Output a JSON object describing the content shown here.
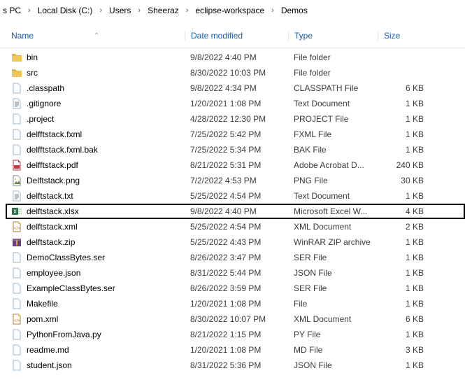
{
  "breadcrumb": [
    {
      "label": "s PC"
    },
    {
      "label": "Local Disk (C:)"
    },
    {
      "label": "Users"
    },
    {
      "label": "Sheeraz"
    },
    {
      "label": "eclipse-workspace"
    },
    {
      "label": "Demos"
    }
  ],
  "columns": {
    "name": "Name",
    "date": "Date modified",
    "type": "Type",
    "size": "Size"
  },
  "files": [
    {
      "icon": "folder",
      "name": "bin",
      "date": "9/8/2022 4:40 PM",
      "type": "File folder",
      "size": ""
    },
    {
      "icon": "folder",
      "name": "src",
      "date": "8/30/2022 10:03 PM",
      "type": "File folder",
      "size": ""
    },
    {
      "icon": "file",
      "name": ".classpath",
      "date": "9/8/2022 4:34 PM",
      "type": "CLASSPATH File",
      "size": "6 KB"
    },
    {
      "icon": "text",
      "name": ".gitignore",
      "date": "1/20/2021 1:08 PM",
      "type": "Text Document",
      "size": "1 KB"
    },
    {
      "icon": "file",
      "name": ".project",
      "date": "4/28/2022 12:30 PM",
      "type": "PROJECT File",
      "size": "1 KB"
    },
    {
      "icon": "file",
      "name": "delfftstack.fxml",
      "date": "7/25/2022 5:42 PM",
      "type": "FXML File",
      "size": "1 KB"
    },
    {
      "icon": "file",
      "name": "delfftstack.fxml.bak",
      "date": "7/25/2022 5:34 PM",
      "type": "BAK File",
      "size": "1 KB"
    },
    {
      "icon": "pdf",
      "name": "delfftstack.pdf",
      "date": "8/21/2022 5:31 PM",
      "type": "Adobe Acrobat D...",
      "size": "240 KB"
    },
    {
      "icon": "png",
      "name": "Delftstack.png",
      "date": "7/2/2022 4:53 PM",
      "type": "PNG File",
      "size": "30 KB"
    },
    {
      "icon": "text",
      "name": "delftstack.txt",
      "date": "5/25/2022 4:54 PM",
      "type": "Text Document",
      "size": "1 KB"
    },
    {
      "icon": "xlsx",
      "name": "delftstack.xlsx",
      "date": "9/8/2022 4:40 PM",
      "type": "Microsoft Excel W...",
      "size": "4 KB",
      "highlighted": true
    },
    {
      "icon": "xml",
      "name": "delftstack.xml",
      "date": "5/25/2022 4:54 PM",
      "type": "XML Document",
      "size": "2 KB"
    },
    {
      "icon": "zip",
      "name": "delftstack.zip",
      "date": "5/25/2022 4:43 PM",
      "type": "WinRAR ZIP archive",
      "size": "1 KB"
    },
    {
      "icon": "file",
      "name": "DemoClassBytes.ser",
      "date": "8/26/2022 3:47 PM",
      "type": "SER File",
      "size": "1 KB"
    },
    {
      "icon": "file",
      "name": "employee.json",
      "date": "8/31/2022 5:44 PM",
      "type": "JSON File",
      "size": "1 KB"
    },
    {
      "icon": "file",
      "name": "ExampleClassBytes.ser",
      "date": "8/26/2022 3:59 PM",
      "type": "SER File",
      "size": "1 KB"
    },
    {
      "icon": "file",
      "name": "Makefile",
      "date": "1/20/2021 1:08 PM",
      "type": "File",
      "size": "1 KB"
    },
    {
      "icon": "xml",
      "name": "pom.xml",
      "date": "8/30/2022 10:07 PM",
      "type": "XML Document",
      "size": "6 KB"
    },
    {
      "icon": "file",
      "name": "PythonFromJava.py",
      "date": "8/21/2022 1:15 PM",
      "type": "PY File",
      "size": "1 KB"
    },
    {
      "icon": "file",
      "name": "readme.md",
      "date": "1/20/2021 1:08 PM",
      "type": "MD File",
      "size": "3 KB"
    },
    {
      "icon": "file",
      "name": "student.json",
      "date": "8/31/2022 5:36 PM",
      "type": "JSON File",
      "size": "1 KB"
    }
  ]
}
